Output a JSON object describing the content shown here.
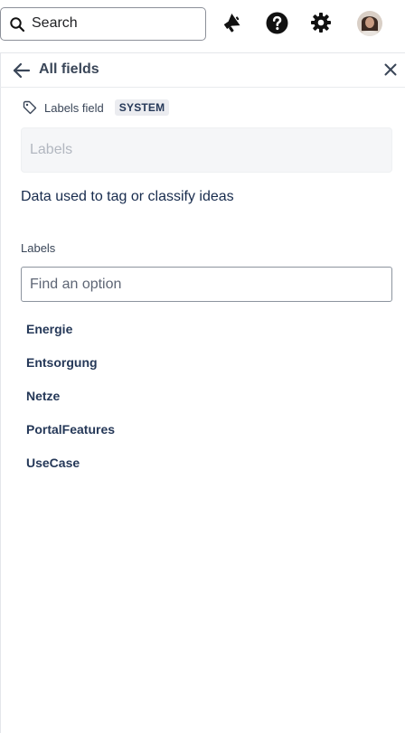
{
  "topbar": {
    "search_label": "Search",
    "icons": [
      "search-icon",
      "megaphone-icon",
      "help-icon",
      "gear-icon"
    ]
  },
  "panel": {
    "back_icon": "arrow-left-icon",
    "title": "All fields",
    "close_icon": "close-icon"
  },
  "field": {
    "type_icon": "tag-icon",
    "type_label": "Labels field",
    "badge": "SYSTEM",
    "name_placeholder": "Labels",
    "description": "Data used to tag or classify ideas"
  },
  "options_section": {
    "label": "Labels",
    "find_placeholder": "Find an option",
    "items": [
      {
        "label": "Energie"
      },
      {
        "label": "Entsorgung"
      },
      {
        "label": "Netze"
      },
      {
        "label": "PortalFeatures"
      },
      {
        "label": "UseCase"
      }
    ]
  },
  "colors": {
    "text_primary": "#172b4d",
    "text_secondary": "#3a4658",
    "badge_bg": "#ebecf0",
    "input_disabled_bg": "#f5f6f8",
    "divider": "#e4e6ea"
  }
}
